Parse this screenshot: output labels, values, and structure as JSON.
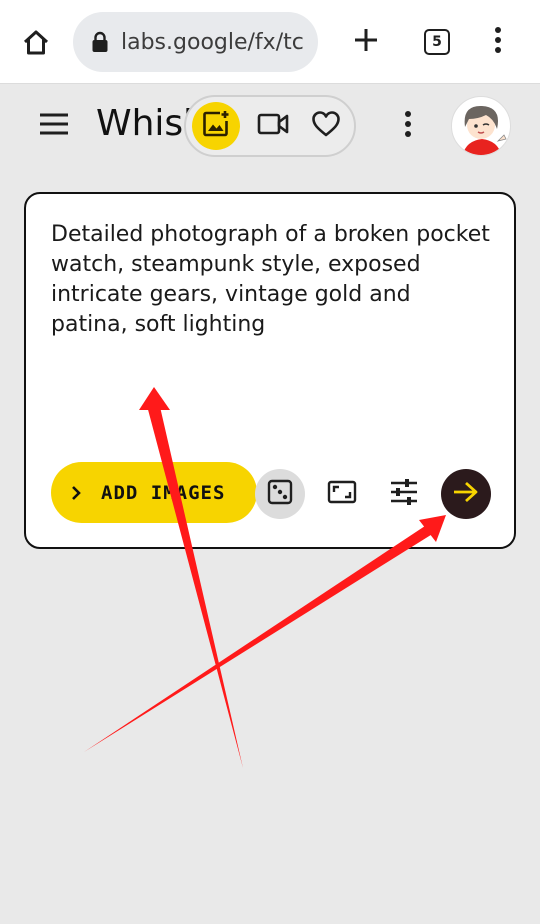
{
  "browser": {
    "url": "labs.google/fx/tc",
    "tab_count": "5",
    "icons": [
      "home-icon",
      "lock-icon",
      "plus-icon",
      "tabs-icon",
      "more-vert-icon"
    ]
  },
  "app": {
    "title": "Whisk",
    "modes": [
      "image-mode",
      "video-mode",
      "favorites"
    ],
    "active_mode": "image-mode",
    "accent_color": "#f7d400"
  },
  "prompt": {
    "text": "Detailed photograph of a broken pocket watch, steampunk style, exposed intricate gears, vintage gold and patina, soft lighting"
  },
  "toolbar": {
    "add_images_label": "ADD IMAGES",
    "icons": [
      "dice-icon",
      "aspect-ratio-icon",
      "tune-icon",
      "arrow-forward-icon"
    ],
    "submit_color": "#2b1a1c",
    "submit_arrow_color": "#f7d400"
  },
  "annotations": {
    "arrow_color": "#ff1a1a"
  }
}
